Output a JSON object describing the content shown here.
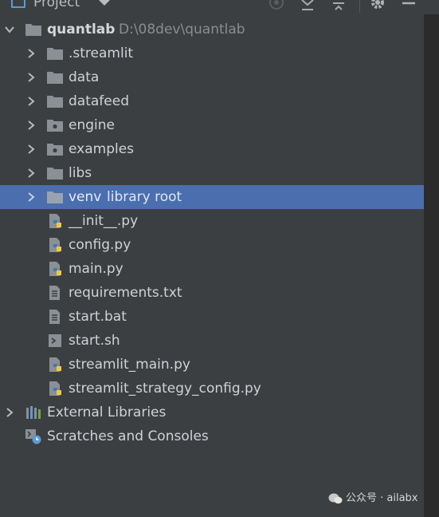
{
  "header": {
    "title": "Project",
    "icons": [
      "project-icon",
      "dropdown-icon",
      "locate-icon",
      "expand-all-icon",
      "collapse-all-icon",
      "gear-icon",
      "minimize-icon"
    ]
  },
  "tree": {
    "root": {
      "label": "quantlab",
      "path": "D:\\08dev\\quantlab",
      "expanded": true
    },
    "children": [
      {
        "label": ".streamlit",
        "icon": "folder-icon",
        "type": "folder"
      },
      {
        "label": "data",
        "icon": "folder-icon",
        "type": "folder"
      },
      {
        "label": "datafeed",
        "icon": "folder-icon",
        "type": "folder"
      },
      {
        "label": "engine",
        "icon": "package-folder-icon",
        "type": "package"
      },
      {
        "label": "examples",
        "icon": "package-folder-icon",
        "type": "package"
      },
      {
        "label": "libs",
        "icon": "folder-icon",
        "type": "folder"
      },
      {
        "label": "venv",
        "suffix": "library root",
        "icon": "folder-icon",
        "type": "folder",
        "selected": true
      },
      {
        "label": "__init__.py",
        "icon": "python-file-icon",
        "type": "file"
      },
      {
        "label": "config.py",
        "icon": "python-file-icon",
        "type": "file"
      },
      {
        "label": "main.py",
        "icon": "python-file-icon",
        "type": "file"
      },
      {
        "label": "requirements.txt",
        "icon": "text-file-icon",
        "type": "file"
      },
      {
        "label": "start.bat",
        "icon": "text-file-icon",
        "type": "file"
      },
      {
        "label": "start.sh",
        "icon": "shell-file-icon",
        "type": "file"
      },
      {
        "label": "streamlit_main.py",
        "icon": "python-file-icon",
        "type": "file"
      },
      {
        "label": "streamlit_strategy_config.py",
        "icon": "python-file-icon",
        "type": "file"
      }
    ],
    "external_libraries": "External Libraries",
    "scratches": "Scratches and Consoles"
  },
  "watermark": {
    "text": "公众号 · ailabx"
  },
  "colors": {
    "panel_bg": "#3c3f41",
    "selection": "#4b6eaf",
    "folder": "#8a9095",
    "python_blue": "#3d7ab8",
    "python_yellow": "#f0c93a"
  }
}
